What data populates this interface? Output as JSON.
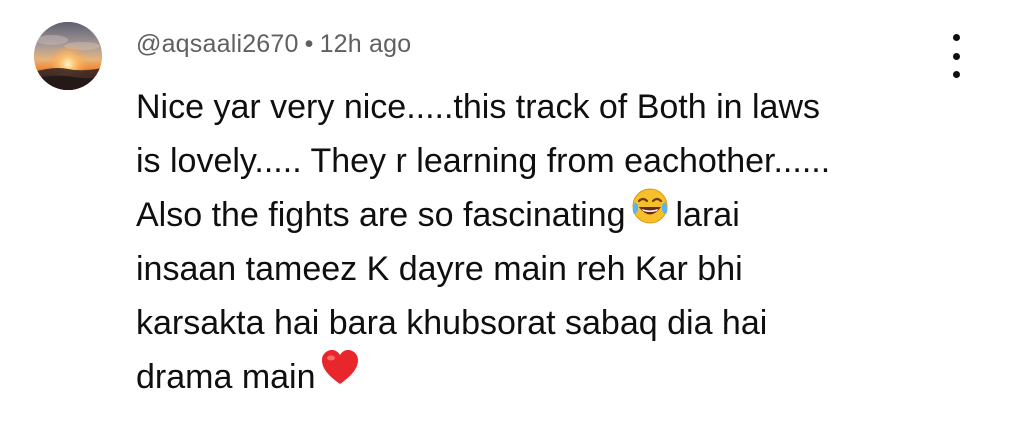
{
  "comment": {
    "author": "@aqsaali2670",
    "separator": "•",
    "timestamp": "12h ago",
    "lines": [
      "Nice yar very nice.....this track of Both in laws",
      "is lovely..... They r learning from eachother......",
      "Also the fights are so fascinating",
      "larai",
      "insaan tameez K dayre main reh Kar bhi",
      "karsakta hai bara khubsorat sabaq dia hai",
      "drama main"
    ],
    "emojis": [
      "face-with-tears-of-joy-icon",
      "red-heart-icon"
    ]
  },
  "colors": {
    "text": "#0f0f0f",
    "meta": "#606060",
    "heart": "#e8262c",
    "joy_face": "#f7c02a"
  }
}
